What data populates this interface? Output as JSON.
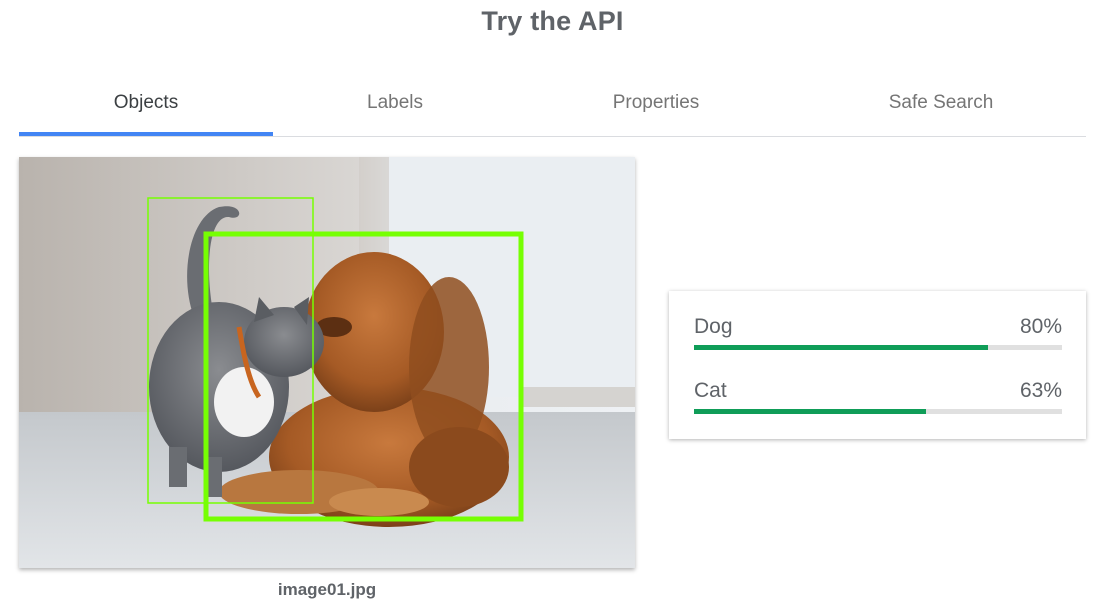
{
  "page": {
    "title": "Try the API"
  },
  "tabs": [
    {
      "label": "Objects",
      "active": true
    },
    {
      "label": "Labels",
      "active": false
    },
    {
      "label": "Properties",
      "active": false
    },
    {
      "label": "Safe Search",
      "active": false
    }
  ],
  "image": {
    "caption": "image01.jpg",
    "detected": [
      "cat",
      "dog"
    ],
    "box_color": "#76ff03"
  },
  "results": [
    {
      "name": "Dog",
      "percent_label": "80%",
      "value": 0.8
    },
    {
      "name": "Cat",
      "percent_label": "63%",
      "value": 0.63
    }
  ],
  "colors": {
    "accent": "#4285f4",
    "bar": "#0f9d58",
    "track": "#e0e0e0"
  }
}
